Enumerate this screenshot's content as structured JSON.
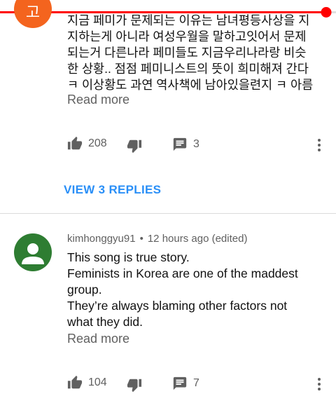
{
  "video": {
    "progress_fraction": 0.97
  },
  "comment1": {
    "avatar_letter": "고",
    "lines": [
      "지금 페미가 문제되는 이유는 남녀평등사상을 지",
      "지하는게 아니라 여성우월을 말하고잇어서 문제",
      "되는거 다른나라 페미들도 지금우리나라랑 비슷",
      "한 상황.. 점점 페미니스트의 뜻이 희미해져 간다",
      "ㅋ 이상황도 과연 역사책에 남아있을련지 ㅋ 아름"
    ],
    "read_more": "Read more",
    "like_count": "208",
    "reply_count": "3",
    "view_replies": "VIEW 3 REPLIES"
  },
  "comment2": {
    "author": "kimhonggyu91",
    "separator": "•",
    "time": "12 hours ago (edited)",
    "lines": [
      "This song is true story.",
      "Feminists in Korea are one of the maddest",
      "group.",
      "They’re always blaming other factors not",
      "what they did."
    ],
    "read_more": "Read more",
    "like_count": "104",
    "reply_count": "7"
  },
  "colors": {
    "accent_red": "#ff0000",
    "link_blue": "#2a8ff7",
    "avatar1": "#f4641e",
    "avatar2": "#2e7d32",
    "secondary_text": "#606060"
  },
  "icons": [
    "thumb-up-icon",
    "thumb-down-icon",
    "comment-icon",
    "more-vert-icon",
    "person-icon"
  ]
}
